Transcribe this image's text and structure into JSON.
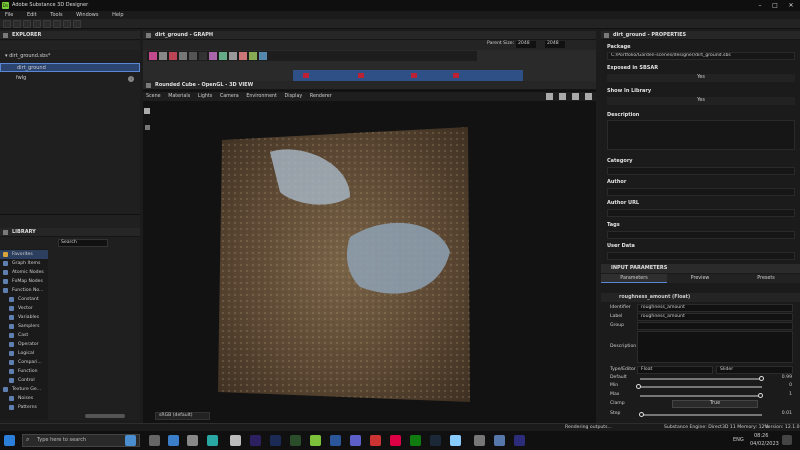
{
  "app": {
    "title": "Adobe Substance 3D Designer"
  },
  "menu": [
    "File",
    "Edit",
    "Tools",
    "Windows",
    "Help"
  ],
  "explorer": {
    "title": "EXPLORER",
    "package": "dirt_ground.sbs*",
    "graph_item": "dirt_ground",
    "folder": "fwlg"
  },
  "library": {
    "title": "LIBRARY",
    "search_placeholder": "Search",
    "categories": [
      "Favorites",
      "Graph Items",
      "Atomic Nodes",
      "FxMap Nodes",
      "Function No...",
      "Constant",
      "Vector",
      "Variables",
      "Samplers",
      "Cast",
      "Operator",
      "Logical",
      "Compari...",
      "Function",
      "Control",
      "Texture Ge...",
      "Noises",
      "Patterns"
    ]
  },
  "graph": {
    "title": "dirt_ground - GRAPH",
    "parent_size_label": "Parent Size:",
    "parent_size": "2048",
    "size2": "2048"
  },
  "view3d": {
    "title": "Rounded Cube - OpenGL - 3D VIEW",
    "tabs": [
      "Scene",
      "Materials",
      "Lights",
      "Camera",
      "Environment",
      "Display",
      "Renderer"
    ],
    "colorspace": "sRGB (default)"
  },
  "properties": {
    "title": "dirt_ground - PROPERTIES",
    "package_label": "Package",
    "package_path": "C:/Portfolio/Garden-scenes/designer/dirt_ground.sbs",
    "exposed_label": "Exposed in SBSAR",
    "exposed_value": "Yes",
    "library_label": "Show In Library",
    "library_value": "Yes",
    "description_label": "Description",
    "category_label": "Category",
    "author_label": "Author",
    "author_url_label": "Author URL",
    "tags_label": "Tags",
    "user_data_label": "User Data",
    "input_params_label": "INPUT PARAMETERS",
    "tabs": [
      "Parameters",
      "Preview",
      "Presets"
    ],
    "param_header": "roughness_amount (Float)",
    "identifier_label": "Identifier",
    "identifier_value": "roughness_amount",
    "label_label": "Label",
    "label_value": "roughness_amount",
    "group_label": "Group",
    "desc_label": "Description",
    "type_label": "Type/Editor",
    "type_value": "Float",
    "editor_value": "Slider",
    "default_label": "Default",
    "default_value": "0.99",
    "default_fraction": 0.99,
    "min_label": "Min",
    "min_value": "0",
    "max_label": "Max",
    "max_value": "1",
    "clamp_label": "Clamp",
    "clamp_value": "True",
    "step_label": "Step",
    "step_value": "0.01",
    "step_fraction": 0.01
  },
  "status": {
    "left": "Rendering outputs...",
    "engine": "Substance Engine: Direct3D 11  Memory: 12%",
    "version": "Version: 12.1.0"
  },
  "taskbar": {
    "search_placeholder": "Type here to search",
    "lang": "ENG",
    "time": "08:26",
    "date": "04/02/2023"
  },
  "colors": {
    "accent": "#3f6fc4",
    "brand": "#7cc33b",
    "panel": "#1f1f1f"
  }
}
